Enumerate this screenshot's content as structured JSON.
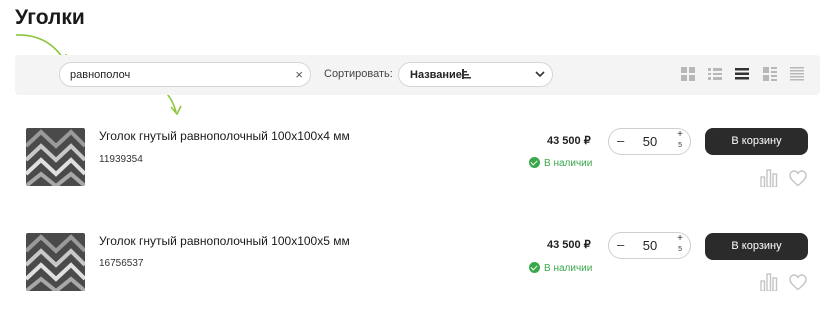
{
  "page": {
    "title": "Уголки"
  },
  "toolbar": {
    "search_value": "равнополоч",
    "clear_icon": "×",
    "sort_label": "Сортировать:",
    "sort_value": "Название"
  },
  "products": [
    {
      "name": "Уголок гнутый равнополочный 100х100х4 мм",
      "code": "11939354",
      "price": "43 500 ₽",
      "stock": "В наличии",
      "qty": "50",
      "qty_minus": "–",
      "qty_plus": "+",
      "qty_unit": "5",
      "cart_label": "В корзину"
    },
    {
      "name": "Уголок гнутый равнополочный 100х100х5 мм",
      "code": "16756537",
      "price": "43 500 ₽",
      "stock": "В наличии",
      "qty": "50",
      "qty_minus": "–",
      "qty_plus": "+",
      "qty_unit": "5",
      "cart_label": "В корзину"
    }
  ],
  "colors": {
    "accent_arrow": "#8cc63f",
    "stock_green": "#3aa84a",
    "cart_button": "#2b2b2b",
    "toolbar_bg": "#f4f4f4"
  },
  "icons": {
    "view_modes": [
      "grid-tiles-icon",
      "list-bullets-icon",
      "list-lines-icon",
      "list-image-icon",
      "table-lines-icon"
    ],
    "row_actions": [
      "compare-icon",
      "heart-icon"
    ]
  }
}
